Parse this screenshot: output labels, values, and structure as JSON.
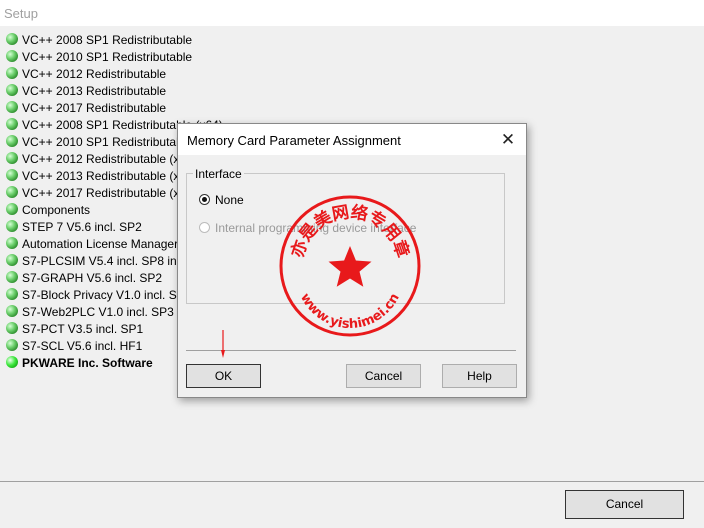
{
  "window": {
    "title": "Setup"
  },
  "components": [
    {
      "label": "VC++ 2008 SP1 Redistributable"
    },
    {
      "label": "VC++ 2010 SP1 Redistributable"
    },
    {
      "label": "VC++ 2012 Redistributable"
    },
    {
      "label": "VC++ 2013 Redistributable"
    },
    {
      "label": "VC++ 2017 Redistributable"
    },
    {
      "label": "VC++ 2008 SP1 Redistributable (x64)"
    },
    {
      "label": "VC++ 2010 SP1 Redistributable (x64)"
    },
    {
      "label": "VC++ 2012 Redistributable (x64)"
    },
    {
      "label": "VC++ 2013 Redistributable (x64)"
    },
    {
      "label": "VC++ 2017 Redistributable (x64)"
    },
    {
      "label": "Components"
    },
    {
      "label": "STEP 7  V5.6 incl. SP2"
    },
    {
      "label": "Automation License Manager"
    },
    {
      "label": "S7-PLCSIM V5.4 incl. SP8 incl."
    },
    {
      "label": "S7-GRAPH  V5.6 incl. SP2"
    },
    {
      "label": "S7-Block Privacy V1.0 incl. SP4"
    },
    {
      "label": "S7-Web2PLC V1.0 incl. SP3"
    },
    {
      "label": "S7-PCT V3.5 incl. SP1"
    },
    {
      "label": "S7-SCL V5.6 incl. HF1"
    },
    {
      "label": "PKWARE Inc. Software"
    }
  ],
  "main": {
    "cancel_label": "Cancel"
  },
  "dialog": {
    "title": "Memory Card Parameter Assignment",
    "close_glyph": "✕",
    "group_label": "Interface",
    "options": [
      {
        "label": "None",
        "checked": true,
        "enabled": true
      },
      {
        "label": "Internal programming device interface",
        "checked": false,
        "enabled": false
      }
    ],
    "ok_label": "OK",
    "cancel_label": "Cancel",
    "help_label": "Help"
  },
  "watermark": {
    "top_text": "亦是美网络专用章",
    "bottom_text": "www.yishimei.cn",
    "color": "#e8191b"
  }
}
